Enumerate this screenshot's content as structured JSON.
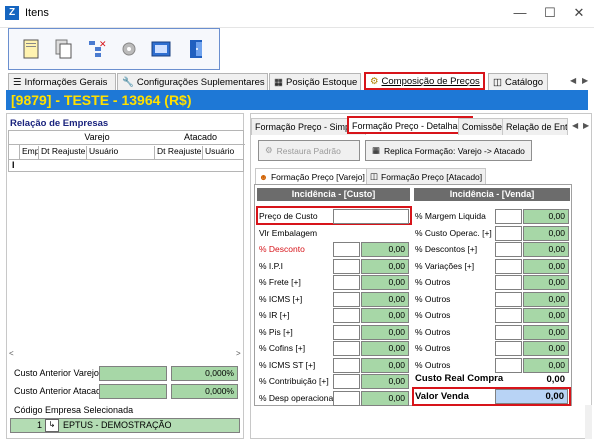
{
  "window": {
    "title": "Itens",
    "app_icon_letter": "Z"
  },
  "tabs": [
    {
      "label": "Informações Gerais",
      "icon": "info-tab-icon"
    },
    {
      "label": "Configurações Suplementares",
      "icon": "wrench-icon"
    },
    {
      "label": "Posição Estoque",
      "icon": "stock-icon"
    },
    {
      "label": "Composição de Preços",
      "icon": "price-icon",
      "active": true
    },
    {
      "label": "Catálogo",
      "icon": "catalog-icon"
    }
  ],
  "banner": "[9879] - TESTE - 13964 (R$)",
  "left": {
    "title": "Relação de Empresas",
    "group_varejo": "Varejo",
    "group_atacado": "Atacado",
    "cols": [
      "Emp",
      "Dt Reajuste",
      "Usuário",
      "Dt Reajuste",
      "Usuário"
    ],
    "row_marker": "I",
    "custo_varejo_label": "Custo Anterior Varejo",
    "custo_varejo_pct": "0,000%",
    "custo_atacado_label": "Custo Anterior Atacado",
    "custo_atacado_pct": "0,000%",
    "codigo_label": "Código Empresa Selecionada",
    "codigo_value": "1",
    "empresa_name": "EPTUS - DEMOSTRAÇÃO"
  },
  "right": {
    "tabs": [
      "Formação Preço - Simples",
      "Formação Preço - Detalhada",
      "Comissões",
      "Relação de Entra"
    ],
    "btn_restaura": "Restaura Padrão",
    "btn_replica": "Replica Formação: Varejo -> Atacado",
    "inner_tabs": [
      "Formação Preço [Varejo]",
      "Formação Preço [Atacado]"
    ],
    "head_custo": "Incidência - [Custo]",
    "head_venda": "Incidência - [Venda]",
    "custo_rows": [
      {
        "label": "Preço de Custo",
        "value": ""
      },
      {
        "label": "Vlr Embalagem",
        "value": ""
      },
      {
        "label": "% Desconto",
        "value": "0,00"
      },
      {
        "label": "% I.P.I",
        "value": "0,00"
      },
      {
        "label": "% Frete [+]",
        "value": "0,00"
      },
      {
        "label": "% ICMS [+]",
        "value": "0,00"
      },
      {
        "label": "% IR [+]",
        "value": "0,00"
      },
      {
        "label": "% Pis [+]",
        "value": "0,00"
      },
      {
        "label": "% Cofins [+]",
        "value": "0,00"
      },
      {
        "label": "% ICMS ST [+]",
        "value": "0,00"
      },
      {
        "label": "% Contribuição [+]",
        "value": "0,00"
      },
      {
        "label": "% Desp operacional",
        "value": "0,00"
      }
    ],
    "venda_rows": [
      {
        "label": "% Margem Liquida",
        "value": "0,00"
      },
      {
        "label": "% Custo Operac. [+]",
        "value": "0,00"
      },
      {
        "label": "% Descontos [+]",
        "value": "0,00"
      },
      {
        "label": "% Variações [+]",
        "value": "0,00"
      },
      {
        "label": "% Outros",
        "value": "0,00"
      },
      {
        "label": "% Outros",
        "value": "0,00"
      },
      {
        "label": "% Outros",
        "value": "0,00"
      },
      {
        "label": "% Outros",
        "value": "0,00"
      },
      {
        "label": "% Outros",
        "value": "0,00"
      },
      {
        "label": "% Outros",
        "value": "0,00"
      }
    ],
    "custo_real_label": "Custo Real Compra",
    "custo_real_value": "0,00",
    "valor_venda_label": "Valor Venda",
    "valor_venda_value": "0,00",
    "colors": {
      "red_highlight": "#d7141a",
      "green_field": "#a7d7a7",
      "banner_bg": "#1e78d6",
      "banner_text": "#ffe000",
      "desconto_label": "#d7141a"
    }
  }
}
